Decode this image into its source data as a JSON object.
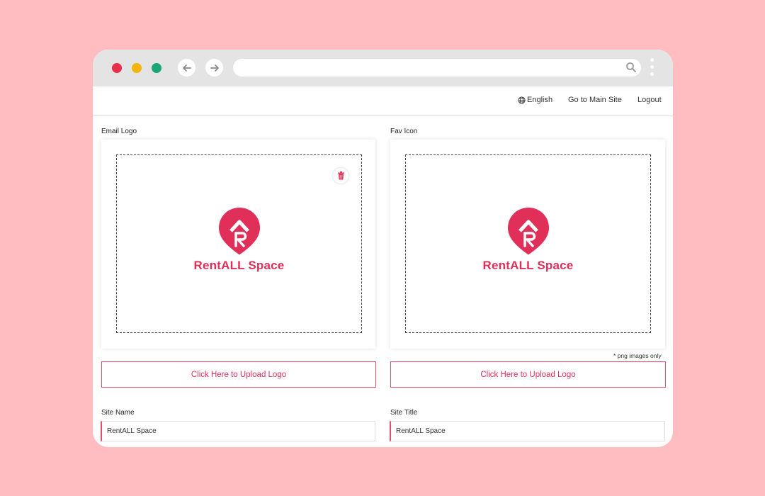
{
  "topbar": {
    "language": "English",
    "main_site": "Go to Main Site",
    "logout": "Logout"
  },
  "email_logo": {
    "label": "Email Logo",
    "brand_text": "RentALL Space",
    "upload_label": "Click Here to Upload Logo"
  },
  "fav_icon": {
    "label": "Fav Icon",
    "brand_text": "RentALL Space",
    "upload_label": "Click Here to Upload Logo",
    "note": "* png images only"
  },
  "site_name": {
    "label": "Site Name",
    "value": "RentALL Space"
  },
  "site_title": {
    "label": "Site Title",
    "value": "RentALL Space"
  },
  "colors": {
    "accent": "#e0305a",
    "background": "#ffbcc1",
    "dot_red": "#e5304a",
    "dot_yellow": "#f2b406",
    "dot_green": "#1aa57a"
  },
  "icons": [
    "back-arrow-icon",
    "forward-arrow-icon",
    "search-icon",
    "menu-kebab-icon",
    "globe-icon",
    "trash-icon",
    "location-pin-logo"
  ]
}
